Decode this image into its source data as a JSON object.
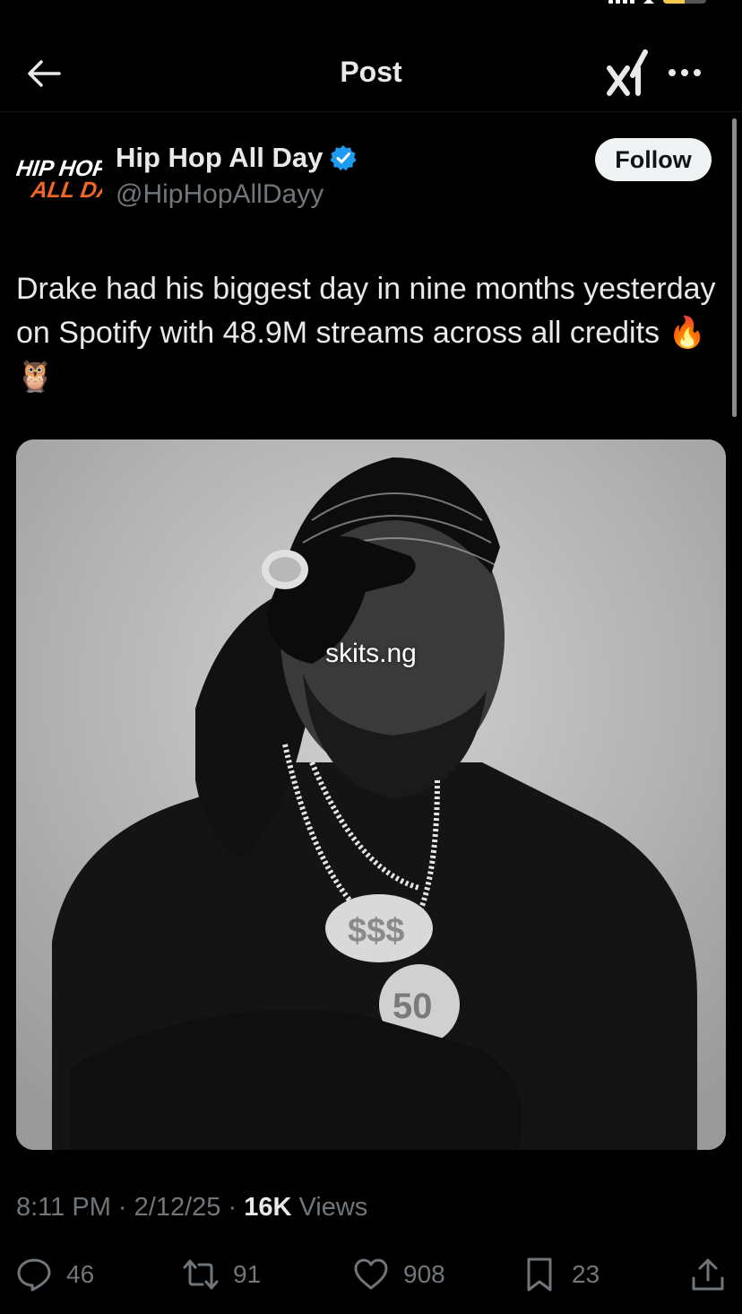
{
  "nav": {
    "title": "Post"
  },
  "author": {
    "name": "Hip Hop All Day",
    "handle": "@HipHopAllDayy",
    "logo_text_line1": "HIP HOP",
    "logo_text_line2": "ALL DAY",
    "verified": true
  },
  "follow": {
    "label": "Follow"
  },
  "post": {
    "text": "Drake had his biggest day in nine months yesterday on Spotify with 48.9M streams across all credits 🔥 🦉",
    "watermark": "skits.ng"
  },
  "meta": {
    "time": "8:11 PM",
    "date": "2/12/25",
    "views_count": "16K",
    "views_label": "Views"
  },
  "actions": {
    "replies": "46",
    "reposts": "91",
    "likes": "908",
    "bookmarks": "23"
  },
  "colors": {
    "background": "#000000",
    "text_primary": "#e7e9ea",
    "text_secondary": "#71767b",
    "verified_blue": "#1d9bf0",
    "logo_orange": "#f26722"
  },
  "icons": [
    "back-arrow-icon",
    "grok-icon",
    "more-icon",
    "verified-badge-icon",
    "reply-icon",
    "repost-icon",
    "like-icon",
    "bookmark-icon",
    "share-icon"
  ]
}
